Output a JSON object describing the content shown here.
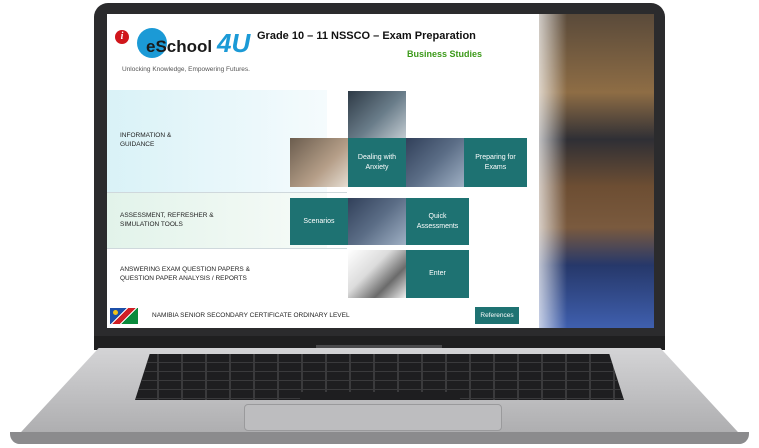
{
  "header": {
    "logo_text": "eSchool",
    "logo_suffix": "4U",
    "tagline": "Unlocking Knowledge, Empowering Futures.",
    "title": "Grade 10 – 11  NSSCO – Exam Preparation",
    "subtitle": "Business Studies"
  },
  "sections": [
    {
      "label": "INFORMATION &\nGUIDANCE"
    },
    {
      "label": "ASSESSMENT, REFRESHER &\nSIMULATION TOOLS"
    },
    {
      "label": "ANSWERING EXAM QUESTION PAPERS &\nQUESTION PAPER ANALYSIS / REPORTS"
    }
  ],
  "tiles": {
    "dealing_with_anxiety": "Dealing with\nAnxiety",
    "preparing_for_exams": "Preparing for\nExams",
    "scenarios": "Scenarios",
    "quick_assessments": "Quick\nAssessments",
    "enter": "Enter"
  },
  "footer": {
    "text": "NAMIBIA SENIOR SECONDARY CERTIFICATE ORDINARY LEVEL",
    "references_button": "References"
  },
  "icons": {
    "info": "info-icon",
    "flag": "namibia-flag-icon"
  },
  "colors": {
    "tile": "#1e7272",
    "accent_green": "#3c9a1a",
    "logo_blue": "#1b9ad6",
    "info_red": "#d0161b"
  }
}
